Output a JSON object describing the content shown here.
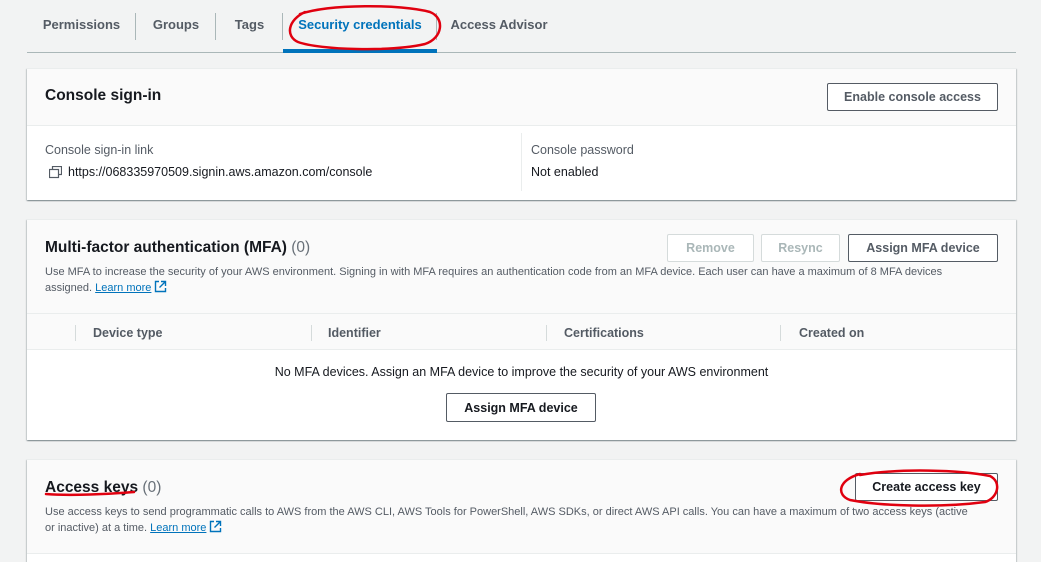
{
  "tabs": [
    {
      "label": "Permissions"
    },
    {
      "label": "Groups"
    },
    {
      "label": "Tags"
    },
    {
      "label": "Security credentials",
      "active": true
    },
    {
      "label": "Access Advisor"
    }
  ],
  "console_signin": {
    "title": "Console sign-in",
    "enable_button": "Enable console access",
    "link_label": "Console sign-in link",
    "link_value": "https://068335970509.signin.aws.amazon.com/console",
    "password_label": "Console password",
    "password_value": "Not enabled"
  },
  "mfa": {
    "title": "Multi-factor authentication (MFA)",
    "count": "(0)",
    "remove_button": "Remove",
    "resync_button": "Resync",
    "assign_button": "Assign MFA device",
    "description": "Use MFA to increase the security of your AWS environment. Signing in with MFA requires an authentication code from an MFA device. Each user can have a maximum of 8 MFA devices assigned.",
    "learn_more": "Learn more",
    "columns": [
      "Device type",
      "Identifier",
      "Certifications",
      "Created on"
    ],
    "empty_text": "No MFA devices. Assign an MFA device to improve the security of your AWS environment",
    "empty_assign_button": "Assign MFA device"
  },
  "access_keys": {
    "title": "Access keys",
    "count": "(0)",
    "create_button": "Create access key",
    "description": "Use access keys to send programmatic calls to AWS from the AWS CLI, AWS Tools for PowerShell, AWS SDKs, or direct AWS API calls. You can have a maximum of two access keys (active or inactive) at a time.",
    "learn_more": "Learn more"
  },
  "colors": {
    "accent": "#0073bb",
    "annotation": "#e0000f",
    "background": "#f2f3f3"
  },
  "icons": {
    "copy": "copy-icon",
    "external_link": "external-link-icon"
  }
}
